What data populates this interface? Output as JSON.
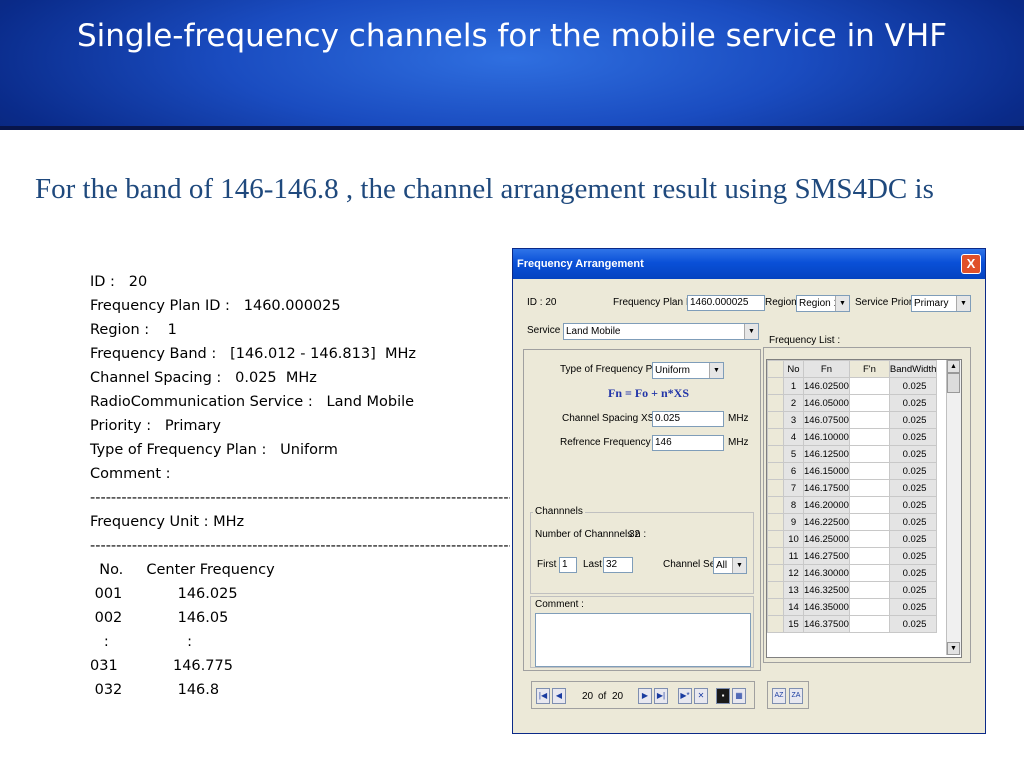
{
  "slide": {
    "title": "Single-frequency channels for the mobile service in VHF",
    "subtitle": "For the band of 146-146.8 , the channel arrangement result using SMS4DC is",
    "text_lines": [
      "ID :   20",
      "Frequency Plan ID :   1460.000025",
      "Region :    1",
      "Frequency Band :   [146.012 - 146.813]  MHz",
      "Channel Spacing :   0.025  MHz",
      "RadioCommunication Service :   Land Mobile",
      "Priority :   Primary",
      "Type of Frequency Plan :   Uniform",
      "Comment :",
      "---------------------------------------------------------------------------------------------",
      "Frequency Unit : MHz",
      "---------------------------------------------------------------------------------------------",
      "  No.     Center Frequency",
      " 001            146.025",
      " 002            146.05",
      "   :                 :",
      "031            146.775",
      " 032            146.8"
    ]
  },
  "dialog": {
    "title": "Frequency Arrangement",
    "close_label": "X",
    "id_label": "ID : 20",
    "plan_id_label": "Frequency Plan ID :",
    "plan_id_value": "1460.000025",
    "region_label": "Region :",
    "region_value": "Region 1",
    "priority_label": "Service Priority :",
    "priority_value": "Primary",
    "service_label": "Service :",
    "service_value": "Land Mobile",
    "plan_type_label": "Type of Frequency Plan :",
    "plan_type_value": "Uniform",
    "formula": "Fn = Fo + n*XS",
    "spacing_label": "Channel Spacing  XS :",
    "spacing_value": "0.025",
    "spacing_unit": "MHz",
    "ref_label": "Refrence Frequency  Fo :",
    "ref_value": "146",
    "ref_unit": "MHz",
    "channels_group": "Channnels",
    "num_channels_label": "Number of Channnels   n :",
    "num_channels_value": "32",
    "first_label": "First :",
    "first_value": "1",
    "last_label": "Last :",
    "last_value": "32",
    "channel_set_label": "Channel Set :",
    "channel_set_value": "All",
    "comment_label": "Comment :",
    "freq_list_label": "Frequency List :",
    "nav_position": "20",
    "nav_of": "of",
    "nav_total": "20"
  },
  "freq_table": {
    "headers": [
      "No",
      "Fn",
      "F'n",
      "BandWidth"
    ],
    "rows": [
      [
        "1",
        "146.02500",
        "",
        "0.025"
      ],
      [
        "2",
        "146.05000",
        "",
        "0.025"
      ],
      [
        "3",
        "146.07500",
        "",
        "0.025"
      ],
      [
        "4",
        "146.10000",
        "",
        "0.025"
      ],
      [
        "5",
        "146.12500",
        "",
        "0.025"
      ],
      [
        "6",
        "146.15000",
        "",
        "0.025"
      ],
      [
        "7",
        "146.17500",
        "",
        "0.025"
      ],
      [
        "8",
        "146.20000",
        "",
        "0.025"
      ],
      [
        "9",
        "146.22500",
        "",
        "0.025"
      ],
      [
        "10",
        "146.25000",
        "",
        "0.025"
      ],
      [
        "11",
        "146.27500",
        "",
        "0.025"
      ],
      [
        "12",
        "146.30000",
        "",
        "0.025"
      ],
      [
        "13",
        "146.32500",
        "",
        "0.025"
      ],
      [
        "14",
        "146.35000",
        "",
        "0.025"
      ],
      [
        "15",
        "146.37500",
        "",
        "0.025"
      ]
    ]
  },
  "icons": {
    "close": "close-icon",
    "dropdown": "chevron-down-icon",
    "nav_first": "first-record-icon",
    "nav_prev": "previous-record-icon",
    "nav_next": "next-record-icon",
    "nav_last": "last-record-icon",
    "save": "save-icon",
    "sort_asc": "sort-ascending-icon",
    "sort_desc": "sort-descending-icon"
  },
  "colors": {
    "header_blue": "#1a4cc0",
    "subtitle_blue": "#1f497d",
    "titlebar_blue": "#0a50d8",
    "formula_blue": "#2235a8"
  }
}
